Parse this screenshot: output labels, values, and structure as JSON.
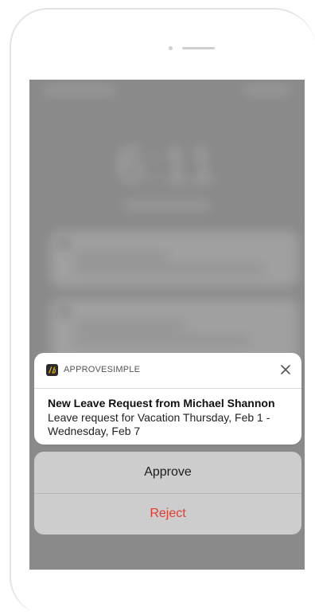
{
  "notification": {
    "app_name": "APPROVESIMPLE",
    "app_icon": "approvesimple-logo-icon",
    "close_icon": "close-icon",
    "title": "New Leave Request from Michael Shannon",
    "body": "Leave request for Vacation Thursday, Feb 1 - Wednesday, Feb 7"
  },
  "actions": {
    "approve_label": "Approve",
    "reject_label": "Reject",
    "reject_color": "#e33b2e"
  },
  "background": {
    "clock_text": "6:11"
  }
}
